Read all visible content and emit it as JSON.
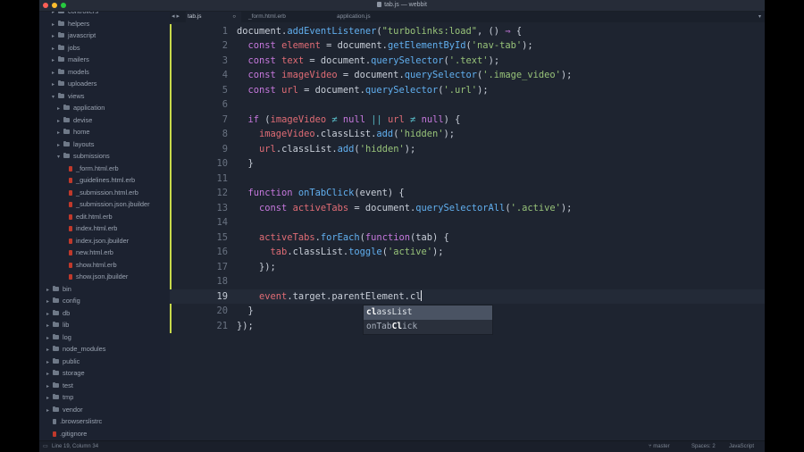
{
  "window": {
    "title": "tab.js — webbit",
    "traffic_lights": [
      "#ff5f56",
      "#ffbd2e",
      "#27c93f"
    ]
  },
  "tree": [
    {
      "label": "controllers",
      "kind": "folder",
      "indent": 1
    },
    {
      "label": "helpers",
      "kind": "folder",
      "indent": 1
    },
    {
      "label": "javascript",
      "kind": "folder",
      "indent": 1
    },
    {
      "label": "jobs",
      "kind": "folder",
      "indent": 1
    },
    {
      "label": "mailers",
      "kind": "folder",
      "indent": 1
    },
    {
      "label": "models",
      "kind": "folder",
      "indent": 1
    },
    {
      "label": "uploaders",
      "kind": "folder",
      "indent": 1
    },
    {
      "label": "views",
      "kind": "folder-open",
      "indent": 1
    },
    {
      "label": "application",
      "kind": "folder",
      "indent": 2
    },
    {
      "label": "devise",
      "kind": "folder",
      "indent": 2
    },
    {
      "label": "home",
      "kind": "folder",
      "indent": 2
    },
    {
      "label": "layouts",
      "kind": "folder",
      "indent": 2
    },
    {
      "label": "submissions",
      "kind": "folder-open",
      "indent": 2
    },
    {
      "label": "_form.html.erb",
      "kind": "file",
      "indent": 3
    },
    {
      "label": "_guidelines.html.erb",
      "kind": "file",
      "indent": 3
    },
    {
      "label": "_submission.html.erb",
      "kind": "file",
      "indent": 3
    },
    {
      "label": "_submission.json.jbuilder",
      "kind": "file",
      "indent": 3
    },
    {
      "label": "edit.html.erb",
      "kind": "file",
      "indent": 3
    },
    {
      "label": "index.html.erb",
      "kind": "file",
      "indent": 3
    },
    {
      "label": "index.json.jbuilder",
      "kind": "file",
      "indent": 3
    },
    {
      "label": "new.html.erb",
      "kind": "file",
      "indent": 3
    },
    {
      "label": "show.html.erb",
      "kind": "file",
      "indent": 3
    },
    {
      "label": "show.json.jbuilder",
      "kind": "file",
      "indent": 3
    },
    {
      "label": "bin",
      "kind": "folder",
      "indent": 0
    },
    {
      "label": "config",
      "kind": "folder",
      "indent": 0
    },
    {
      "label": "db",
      "kind": "folder",
      "indent": 0
    },
    {
      "label": "lib",
      "kind": "folder",
      "indent": 0
    },
    {
      "label": "log",
      "kind": "folder",
      "indent": 0
    },
    {
      "label": "node_modules",
      "kind": "folder",
      "indent": 0
    },
    {
      "label": "public",
      "kind": "folder",
      "indent": 0
    },
    {
      "label": "storage",
      "kind": "folder",
      "indent": 0
    },
    {
      "label": "test",
      "kind": "folder",
      "indent": 0
    },
    {
      "label": "tmp",
      "kind": "folder",
      "indent": 0
    },
    {
      "label": "vendor",
      "kind": "folder",
      "indent": 0
    },
    {
      "label": ".browserslistrc",
      "kind": "file-plain",
      "indent": 0
    },
    {
      "label": ".gitignore",
      "kind": "file-red",
      "indent": 0
    }
  ],
  "tabs": [
    {
      "label": "tab.js",
      "active": true,
      "modified_marker": "○"
    },
    {
      "label": "_form.html.erb",
      "active": false
    },
    {
      "label": "application.js",
      "active": false
    }
  ],
  "tab_nav": "◂ ▸",
  "code_lines": [
    [
      [
        "n",
        "document."
      ],
      [
        "f",
        "addEventListener"
      ],
      [
        "p",
        "("
      ],
      [
        "s",
        "\"turbolinks:load\""
      ],
      [
        "p",
        ", () "
      ],
      [
        "k",
        "⇒"
      ],
      [
        "p",
        " {"
      ]
    ],
    [
      [
        "p",
        "  "
      ],
      [
        "k",
        "const "
      ],
      [
        "v",
        "element"
      ],
      [
        "p",
        " = document."
      ],
      [
        "f",
        "getElementById"
      ],
      [
        "p",
        "("
      ],
      [
        "s",
        "'nav-tab'"
      ],
      [
        "p",
        ");"
      ]
    ],
    [
      [
        "p",
        "  "
      ],
      [
        "k",
        "const "
      ],
      [
        "v",
        "text"
      ],
      [
        "p",
        " = document."
      ],
      [
        "f",
        "querySelector"
      ],
      [
        "p",
        "("
      ],
      [
        "s",
        "'.text'"
      ],
      [
        "p",
        ");"
      ]
    ],
    [
      [
        "p",
        "  "
      ],
      [
        "k",
        "const "
      ],
      [
        "v",
        "imageVideo"
      ],
      [
        "p",
        " = document."
      ],
      [
        "f",
        "querySelector"
      ],
      [
        "p",
        "("
      ],
      [
        "s",
        "'.image_video'"
      ],
      [
        "p",
        ");"
      ]
    ],
    [
      [
        "p",
        "  "
      ],
      [
        "k",
        "const "
      ],
      [
        "v",
        "url"
      ],
      [
        "p",
        " = document."
      ],
      [
        "f",
        "querySelector"
      ],
      [
        "p",
        "("
      ],
      [
        "s",
        "'.url'"
      ],
      [
        "p",
        ");"
      ]
    ],
    [],
    [
      [
        "p",
        "  "
      ],
      [
        "k",
        "if "
      ],
      [
        "p",
        "("
      ],
      [
        "v",
        "imageVideo"
      ],
      [
        "p",
        " "
      ],
      [
        "o",
        "≠"
      ],
      [
        "p",
        " "
      ],
      [
        "k",
        "null"
      ],
      [
        "p",
        " "
      ],
      [
        "o",
        "||"
      ],
      [
        "p",
        " "
      ],
      [
        "v",
        "url"
      ],
      [
        "p",
        " "
      ],
      [
        "o",
        "≠"
      ],
      [
        "p",
        " "
      ],
      [
        "k",
        "null"
      ],
      [
        "p",
        ") {"
      ]
    ],
    [
      [
        "p",
        "    "
      ],
      [
        "v",
        "imageVideo"
      ],
      [
        "p",
        "."
      ],
      [
        "n",
        "classList."
      ],
      [
        "f",
        "add"
      ],
      [
        "p",
        "("
      ],
      [
        "s",
        "'hidden'"
      ],
      [
        "p",
        ");"
      ]
    ],
    [
      [
        "p",
        "    "
      ],
      [
        "v",
        "url"
      ],
      [
        "p",
        "."
      ],
      [
        "n",
        "classList."
      ],
      [
        "f",
        "add"
      ],
      [
        "p",
        "("
      ],
      [
        "s",
        "'hidden'"
      ],
      [
        "p",
        ");"
      ]
    ],
    [
      [
        "p",
        "  }"
      ]
    ],
    [],
    [
      [
        "p",
        "  "
      ],
      [
        "k",
        "function "
      ],
      [
        "f",
        "onTabClick"
      ],
      [
        "p",
        "(event) {"
      ]
    ],
    [
      [
        "p",
        "    "
      ],
      [
        "k",
        "const "
      ],
      [
        "v",
        "activeTabs"
      ],
      [
        "p",
        " = document."
      ],
      [
        "f",
        "querySelectorAll"
      ],
      [
        "p",
        "("
      ],
      [
        "s",
        "'.active'"
      ],
      [
        "p",
        ");"
      ]
    ],
    [],
    [
      [
        "p",
        "    "
      ],
      [
        "v",
        "activeTabs"
      ],
      [
        "p",
        "."
      ],
      [
        "f",
        "forEach"
      ],
      [
        "p",
        "("
      ],
      [
        "k",
        "function"
      ],
      [
        "p",
        "(tab) {"
      ]
    ],
    [
      [
        "p",
        "      "
      ],
      [
        "v",
        "tab"
      ],
      [
        "p",
        "."
      ],
      [
        "n",
        "classList."
      ],
      [
        "f",
        "toggle"
      ],
      [
        "p",
        "("
      ],
      [
        "s",
        "'active'"
      ],
      [
        "p",
        ");"
      ]
    ],
    [
      [
        "p",
        "    });"
      ]
    ],
    [],
    [
      [
        "p",
        "    "
      ],
      [
        "v",
        "event"
      ],
      [
        "p",
        ".target.parentElement.cl"
      ]
    ],
    [
      [
        "p",
        "  }"
      ]
    ],
    [
      [
        "p",
        "});"
      ]
    ]
  ],
  "current_line": 19,
  "autocomplete": [
    {
      "match": "cl",
      "rest": "assList",
      "selected": true
    },
    {
      "match_pre": "onTab",
      "match": "Cl",
      "rest": "ick",
      "selected": false
    }
  ],
  "status": {
    "position": "Line 19, Column 34",
    "indent": "master",
    "spaces": "Spaces: 2",
    "syntax": "JavaScript"
  }
}
